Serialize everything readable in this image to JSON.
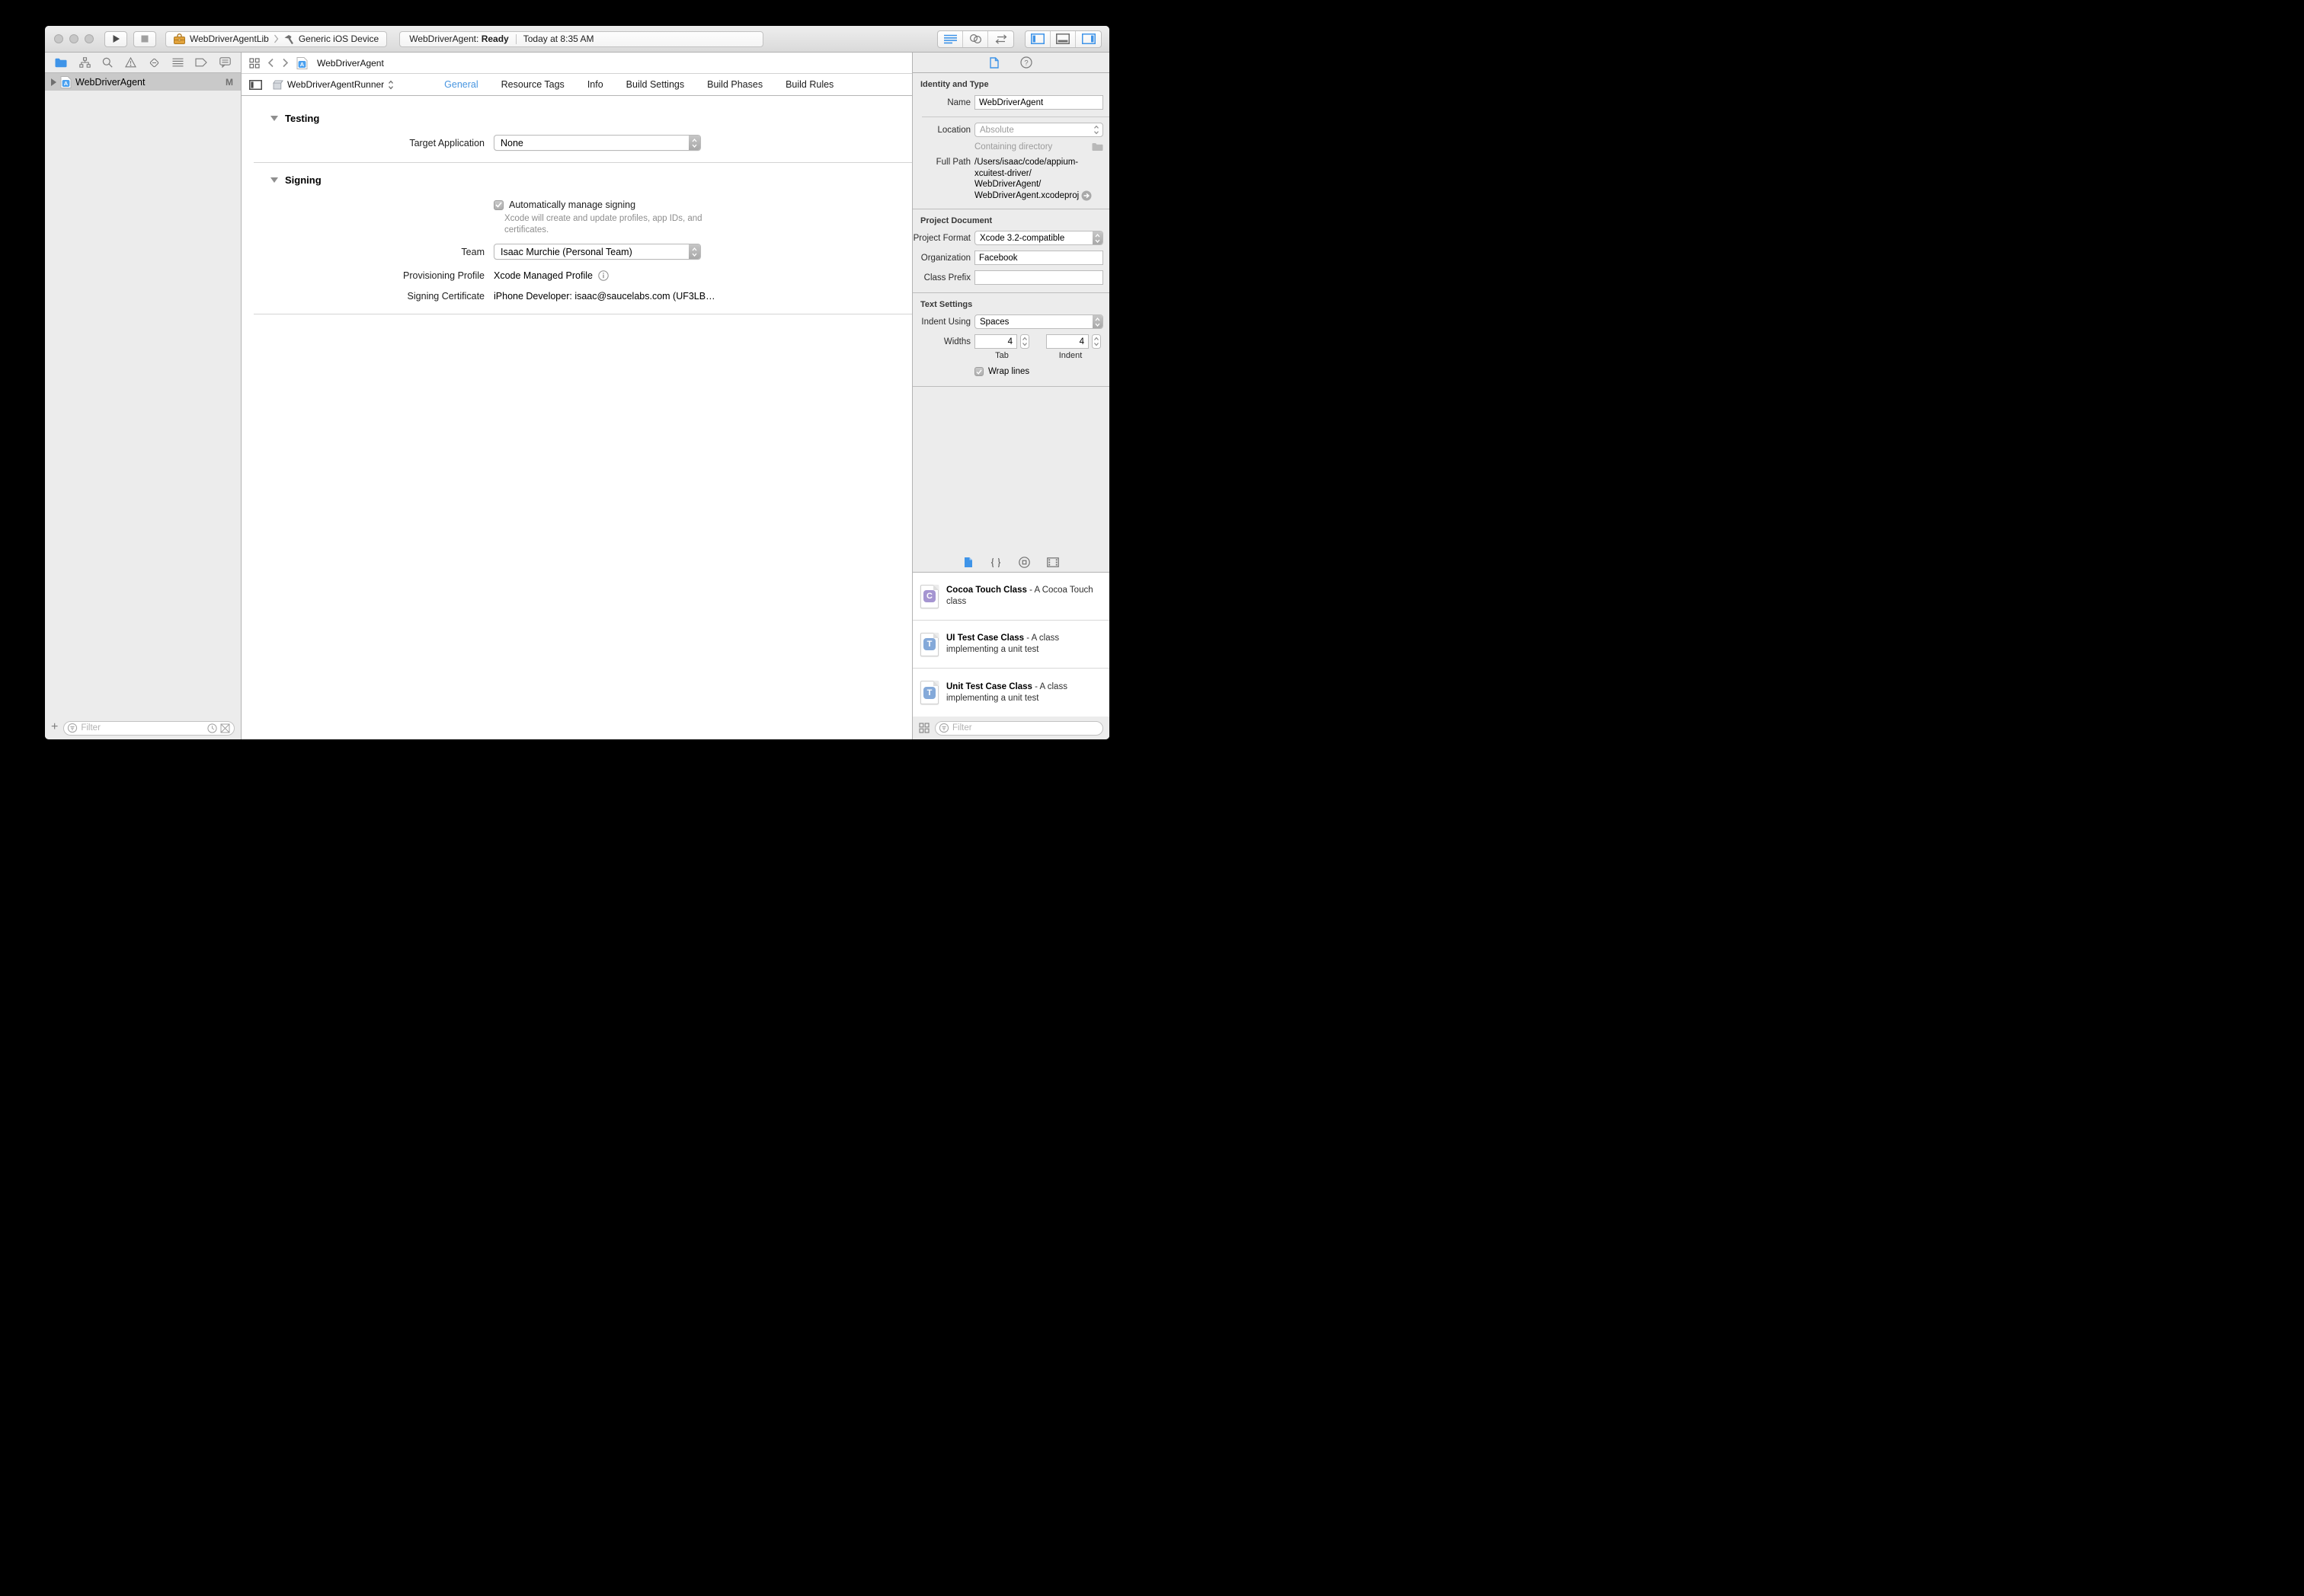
{
  "toolbar": {
    "scheme": {
      "project": "WebDriverAgentLib",
      "destination": "Generic iOS Device"
    },
    "status": {
      "target": "WebDriverAgent:",
      "state": "Ready",
      "time": "Today at 8:35 AM"
    }
  },
  "sidebar": {
    "project": {
      "name": "WebDriverAgent",
      "badge": "M"
    },
    "add_label": "+",
    "filter_placeholder": "Filter"
  },
  "editor": {
    "jumpbar_title": "WebDriverAgent",
    "target_popup": "WebDriverAgentRunner",
    "tabs": [
      "General",
      "Resource Tags",
      "Info",
      "Build Settings",
      "Build Phases",
      "Build Rules"
    ],
    "active_tab": "General",
    "testing": {
      "title": "Testing",
      "target_app_label": "Target Application",
      "target_app_value": "None"
    },
    "signing": {
      "title": "Signing",
      "auto_label": "Automatically manage signing",
      "auto_note": "Xcode will create and update profiles, app IDs, and certificates.",
      "team_label": "Team",
      "team_value": "Isaac Murchie (Personal Team)",
      "profile_label": "Provisioning Profile",
      "profile_value": "Xcode Managed Profile",
      "cert_label": "Signing Certificate",
      "cert_value": "iPhone Developer: isaac@saucelabs.com (UF3LB…"
    }
  },
  "inspector": {
    "identity": {
      "header": "Identity and Type",
      "name_label": "Name",
      "name_value": "WebDriverAgent",
      "location_label": "Location",
      "location_value": "Absolute",
      "containing_placeholder": "Containing directory",
      "path_label": "Full Path",
      "path_lines": [
        "/Users/isaac/code/appium-",
        "xcuitest-driver/",
        "WebDriverAgent/",
        "WebDriverAgent.xcodeproj"
      ]
    },
    "document": {
      "header": "Project Document",
      "format_label": "Project Format",
      "format_value": "Xcode 3.2-compatible",
      "org_label": "Organization",
      "org_value": "Facebook",
      "prefix_label": "Class Prefix",
      "prefix_value": ""
    },
    "text": {
      "header": "Text Settings",
      "indent_label": "Indent Using",
      "indent_value": "Spaces",
      "widths_label": "Widths",
      "tab_width": "4",
      "indent_width": "4",
      "tab_caption": "Tab",
      "indent_caption": "Indent",
      "wrap_label": "Wrap lines"
    },
    "library": {
      "items": [
        {
          "letter": "C",
          "color": "#a595d1",
          "name": "Cocoa Touch Class",
          "desc": "- A Cocoa Touch class"
        },
        {
          "letter": "T",
          "color": "#84a9d9",
          "name": "UI Test Case Class",
          "desc": "- A class implementing a unit test"
        },
        {
          "letter": "T",
          "color": "#84a9d9",
          "name": "Unit Test Case Class",
          "desc": "- A class implementing a unit test"
        }
      ],
      "filter_placeholder": "Filter"
    }
  },
  "colors": {
    "accent": "#3f94e8",
    "selection": "#c9c9c9",
    "toolbox": "#e2a33c"
  }
}
